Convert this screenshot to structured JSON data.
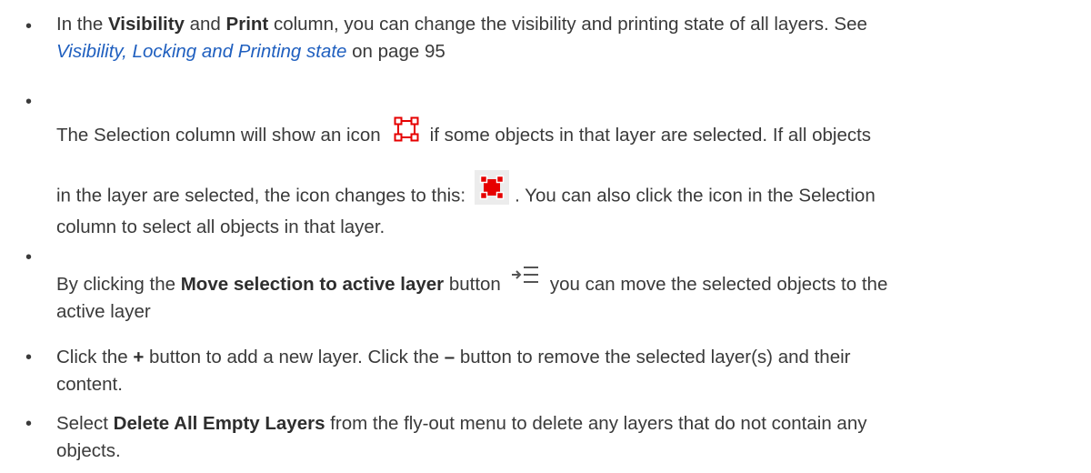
{
  "bullets": [
    {
      "line1_pre": "In the ",
      "visibility": "Visibility",
      "and": " and ",
      "print": "Print",
      "line1_post": " column, you can change the visibility and printing state of all layers. See",
      "link_text": "Visibility, Locking and Printing state",
      "line2_post": " on page 95"
    },
    {
      "line1_pre": "The Selection column will show an icon",
      "line1_post": "if some objects in that layer are selected. If all objects",
      "line2_pre": "in the layer are selected, the icon changes to this:",
      "line2_post": ". You can also click the icon in the Selection",
      "line3": "column to select all objects in that layer."
    },
    {
      "line1_pre": "By clicking the ",
      "bold": "Move selection to active layer",
      "line1_mid": " button",
      "line1_post": "you can move the selected objects to the",
      "line2": "active layer"
    },
    {
      "line1_pre": "Click the ",
      "plus": "+",
      "line1_mid": " button to add a new layer. Click the ",
      "minus": "–",
      "line1_post": " button to remove the selected layer(s) and their",
      "line2": "content."
    },
    {
      "line1_pre": "Select ",
      "bold": "Delete All Empty Layers",
      "line1_post": " from the fly-out menu to delete any layers that do not contain any",
      "line2": "objects."
    }
  ],
  "bullet_char": "•",
  "colors": {
    "text": "#3a3a3a",
    "link": "#1f5fbf",
    "icon_red": "#e60000",
    "icon_bg": "#ececec",
    "move_icon": "#555555"
  },
  "icons": {
    "selection_partial": "selection-partial-icon",
    "selection_full": "selection-full-icon",
    "move_selection": "move-selection-icon"
  }
}
